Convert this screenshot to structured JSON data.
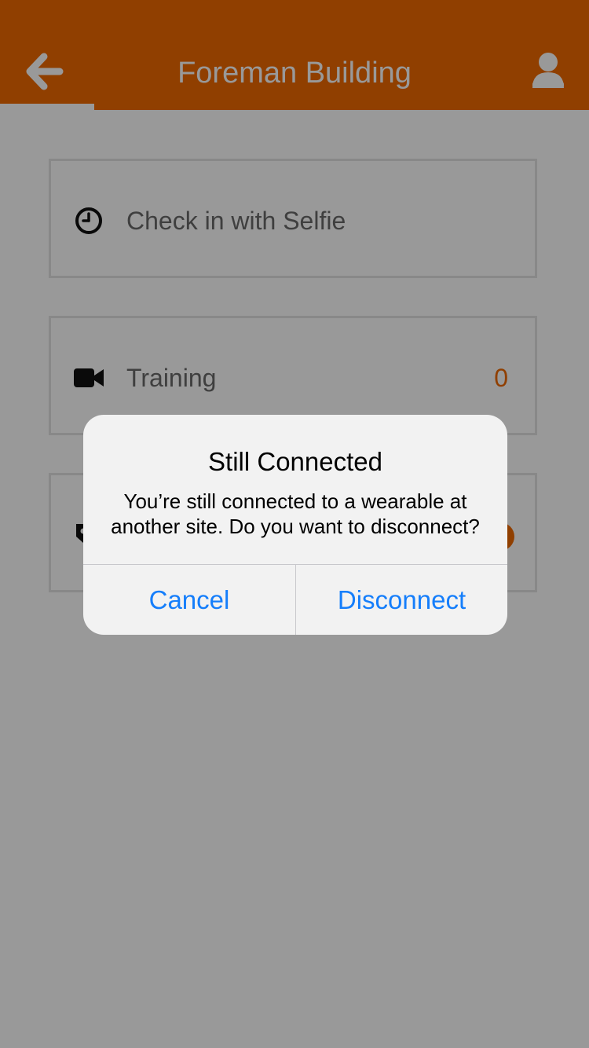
{
  "header": {
    "title": "Foreman Building",
    "back_icon": "arrow-left-icon",
    "profile_icon": "user-icon",
    "background_color": "#f06a00"
  },
  "rows": [
    {
      "label": "Check in with Selfie",
      "icon": "clock-icon"
    },
    {
      "label": "Training",
      "icon": "video-camera-icon",
      "count": "0"
    },
    {
      "label": "",
      "icon": "tag-icon",
      "badge_icon": "alert-icon"
    }
  ],
  "alert": {
    "title": "Still Connected",
    "message": "You’re still connected to a wearable at another site. Do you want to disconnect?",
    "cancel_label": "Cancel",
    "disconnect_label": "Disconnect",
    "button_color": "#157efb"
  }
}
